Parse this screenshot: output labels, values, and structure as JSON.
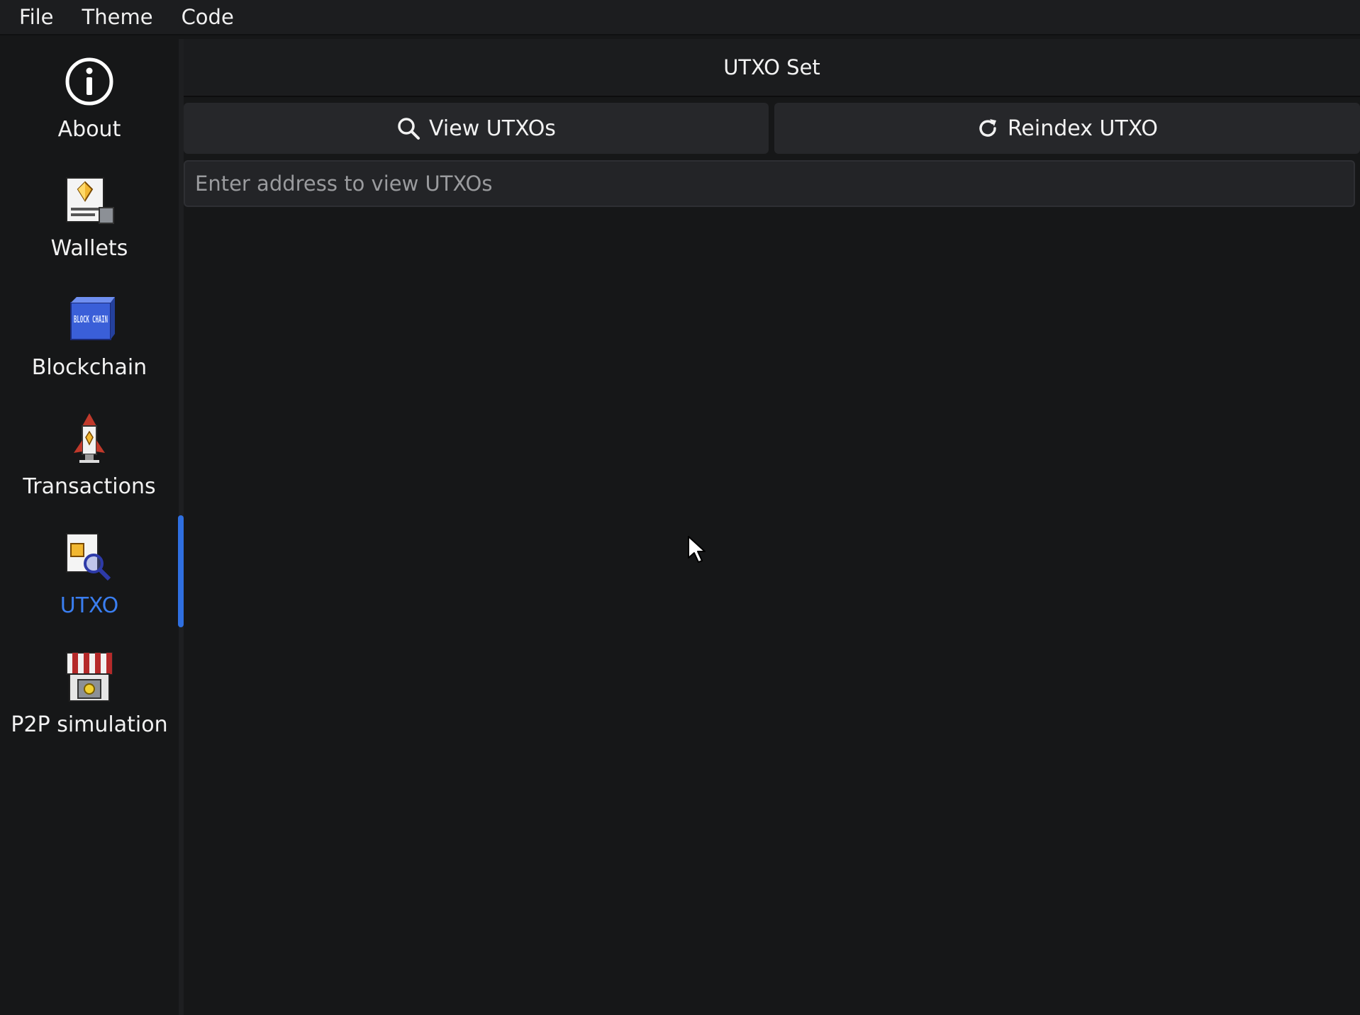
{
  "menubar": {
    "items": [
      "File",
      "Theme",
      "Code"
    ]
  },
  "sidebar": {
    "items": [
      {
        "label": "About",
        "icon": "info-icon",
        "active": false
      },
      {
        "label": "Wallets",
        "icon": "wallet-icon",
        "active": false
      },
      {
        "label": "Blockchain",
        "icon": "blockchain-icon",
        "active": false
      },
      {
        "label": "Transactions",
        "icon": "rocket-icon",
        "active": false
      },
      {
        "label": "UTXO",
        "icon": "utxo-search-icon",
        "active": true
      },
      {
        "label": "P2P simulation",
        "icon": "shop-icon",
        "active": false
      }
    ],
    "icon_text": {
      "blockchain": "BLOCK CHAIN"
    }
  },
  "main": {
    "title": "UTXO Set",
    "view_button": "View UTXOs",
    "reindex_button": "Reindex UTXO",
    "address_input": {
      "value": "",
      "placeholder": "Enter address to view UTXOs"
    }
  },
  "colors": {
    "accent": "#3a7ef0",
    "background": "#161718",
    "button": "#26272a"
  }
}
